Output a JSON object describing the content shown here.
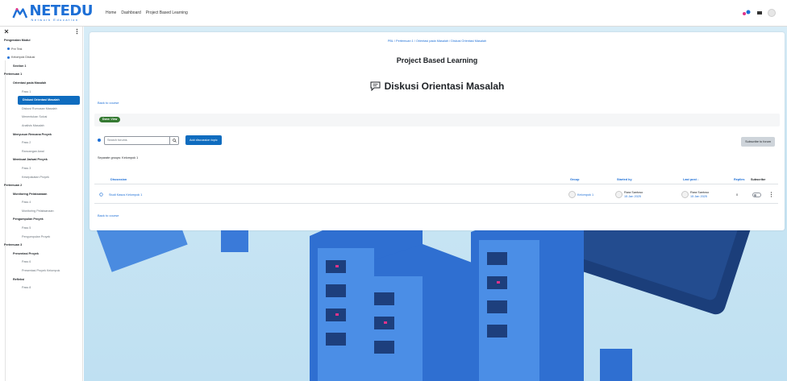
{
  "brand": {
    "name": "NETEDU",
    "tagline": "Network Education"
  },
  "topnav": [
    "Home",
    "Dashboard",
    "Project Based Learning"
  ],
  "sidebar": {
    "items": [
      {
        "label": "Pengenalan Modul",
        "level": "l0"
      },
      {
        "label": "Pre Test",
        "level": "l1",
        "bullet": true
      },
      {
        "label": "Kelompok Diskusi",
        "level": "l1",
        "bullet": true
      },
      {
        "label": "Section 1",
        "level": "l2"
      },
      {
        "label": "Pertemuan 1",
        "level": "l0"
      },
      {
        "label": "Orientasi pada Masalah",
        "level": "l2"
      },
      {
        "label": "Pass 1",
        "level": "l3"
      },
      {
        "label": "Diskusi Orientasi Masalah",
        "level": "active"
      },
      {
        "label": "Diskusi Rumusan Masalah",
        "level": "l3"
      },
      {
        "label": "Menentukan Solusi",
        "level": "l3"
      },
      {
        "label": "Analisis Masalah",
        "level": "l3"
      },
      {
        "label": "Menyusun Rencana Proyek",
        "level": "l2"
      },
      {
        "label": "Pass 2",
        "level": "l3"
      },
      {
        "label": "Rancangan Awal",
        "level": "l3"
      },
      {
        "label": "Membuat Jadwal Proyek",
        "level": "l2"
      },
      {
        "label": "Pass 3",
        "level": "l3"
      },
      {
        "label": "Kesepakatan Proyek",
        "level": "l3"
      },
      {
        "label": "Pertemuan 2",
        "level": "l0"
      },
      {
        "label": "Monitoring Pelaksanaan",
        "level": "l2"
      },
      {
        "label": "Pass 4",
        "level": "l3"
      },
      {
        "label": "Monitoring Pelaksanaan",
        "level": "l3"
      },
      {
        "label": "Pengumpulan Proyek",
        "level": "l2"
      },
      {
        "label": "Pass 5",
        "level": "l3"
      },
      {
        "label": "Pengumpulan Proyek",
        "level": "l3"
      },
      {
        "label": "Pertemuan 3",
        "level": "l0"
      },
      {
        "label": "Presentasi Proyek",
        "level": "l2"
      },
      {
        "label": "Pass 6",
        "level": "l3"
      },
      {
        "label": "Presentasi Proyek Kelompok",
        "level": "l3"
      },
      {
        "label": "Refleksi",
        "level": "l2"
      },
      {
        "label": "Pass 8",
        "level": "l3"
      }
    ]
  },
  "main": {
    "breadcrumb": "PBL / Pertemuan 1 / Orientasi pada Masalah / Diskusi Orientasi Masalah",
    "course_title": "Project Based Learning",
    "page_title": "Diskusi Orientasi Masalah",
    "back_label": "Back to course",
    "done_label": "Done: View",
    "search_placeholder": "Search forums",
    "add_button": "Add discussion topic",
    "subscribe_button": "Subscribe to forum",
    "groups_label": "Separate groups: Kelompok 1",
    "columns": {
      "discussion": "Discussion",
      "group": "Group",
      "started_by": "Started by",
      "last_post": "Last post ↓",
      "replies": "Replies",
      "subscribe": "Subscribe"
    },
    "row": {
      "discussion": "Studi Kasus Kelompok 1",
      "group": "Kelompok 1",
      "started_by_name": "Rara Santoso",
      "started_by_date": "15 Jan 2025",
      "last_post_name": "Rara Santoso",
      "last_post_date": "15 Jan 2025",
      "replies": "0"
    }
  },
  "colors": {
    "primary": "#0f6cbf",
    "brand": "#1d6fd6",
    "done": "#357a32"
  }
}
